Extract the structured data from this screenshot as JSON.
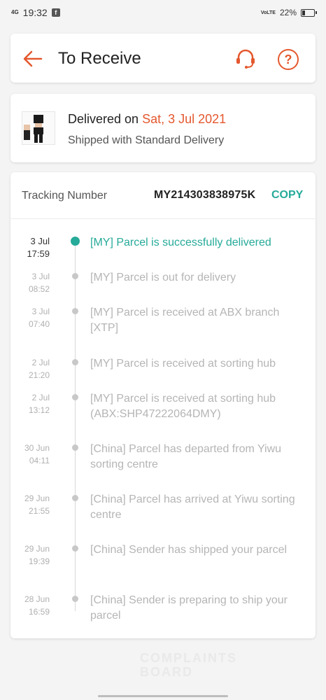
{
  "status_bar": {
    "network": "4G",
    "time": "19:32",
    "app_icon": "facebook-icon",
    "volte": "VoLTE",
    "battery": "22%"
  },
  "header": {
    "title": "To Receive",
    "back_icon": "back-arrow-icon",
    "support_icon": "headset-icon",
    "help_symbol": "?",
    "accent": "#e4582e"
  },
  "delivery": {
    "label": "Delivered on ",
    "date": "Sat, 3 Jul 2021",
    "shipping": "Shipped with Standard Delivery"
  },
  "tracking": {
    "label": "Tracking Number",
    "number": "MY214303838975K",
    "copy_label": "COPY",
    "accent": "#26aa99",
    "events": [
      {
        "date": "3 Jul",
        "time": "17:59",
        "text": "[MY] Parcel is successfully delivered",
        "active": true
      },
      {
        "date": "3 Jul",
        "time": "08:52",
        "text": "[MY] Parcel is out for delivery",
        "active": false
      },
      {
        "date": "3 Jul",
        "time": "07:40",
        "text": "[MY] Parcel is received at ABX branch [XTP]",
        "active": false
      },
      {
        "date": "2 Jul",
        "time": "21:20",
        "text": "[MY] Parcel is received at sorting hub",
        "active": false
      },
      {
        "date": "2 Jul",
        "time": "13:12",
        "text": "[MY] Parcel is received at sorting hub (ABX:SHP47222064DMY)",
        "active": false
      },
      {
        "date": "30 Jun",
        "time": "04:11",
        "text": "[China] Parcel has departed from Yiwu sorting centre",
        "active": false
      },
      {
        "date": "29 Jun",
        "time": "21:55",
        "text": "[China] Parcel has arrived at Yiwu sorting centre",
        "active": false
      },
      {
        "date": "29 Jun",
        "time": "19:39",
        "text": "[China] Sender has shipped your parcel",
        "active": false
      },
      {
        "date": "28 Jun",
        "time": "16:59",
        "text": "[China] Sender is preparing to ship your parcel",
        "active": false
      }
    ]
  },
  "watermark": {
    "line1": "COMPLAINTS",
    "line2": "BOARD"
  }
}
